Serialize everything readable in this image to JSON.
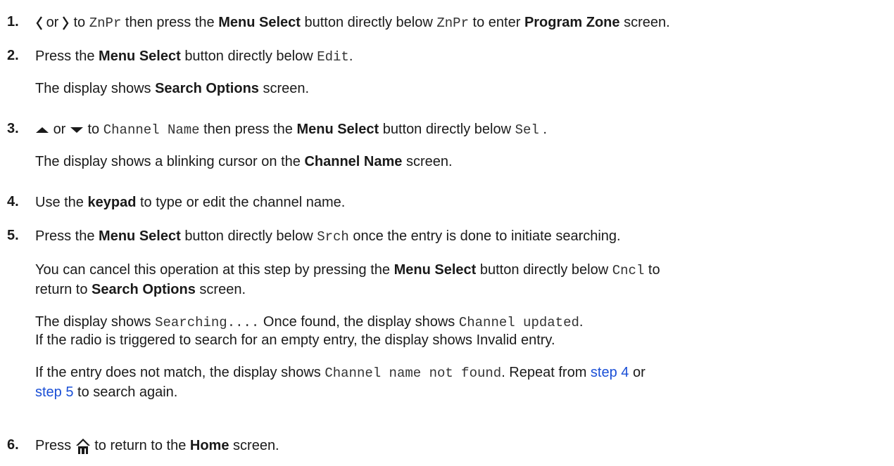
{
  "steps": [
    {
      "num": "1.",
      "l1": {
        "or": "or",
        "to": "to",
        "code1": "ZnPr",
        "t1": "then press the",
        "b1": "Menu Select",
        "t2": "button directly below",
        "code2": "ZnPr",
        "t3": "to enter",
        "b2": "Program Zone",
        "t4": "screen."
      }
    },
    {
      "num": "2.",
      "l1": {
        "t1": "Press the",
        "b1": "Menu Select",
        "t2": "button directly below",
        "code1": "Edit",
        "t3": "."
      },
      "l2": {
        "t1": "The display shows",
        "b1": "Search Options",
        "t2": "screen."
      }
    },
    {
      "num": "3.",
      "l1": {
        "or": "or",
        "to": "to",
        "code1": "Channel Name",
        "t1": "then press the",
        "b1": "Menu Select",
        "t2": "button directly below",
        "code2": "Sel",
        "t3": "."
      },
      "l2": {
        "t1": "The display shows a blinking cursor on the",
        "b1": "Channel Name",
        "t2": "screen."
      }
    },
    {
      "num": "4.",
      "l1": {
        "t1": "Use the",
        "b1": "keypad",
        "t2": "to type or edit the channel name."
      }
    },
    {
      "num": "5.",
      "l1": {
        "t1": "Press the",
        "b1": "Menu Select",
        "t2": "button directly below",
        "code1": "Srch",
        "t3": "once the entry is done to initiate searching."
      },
      "l2": {
        "t1": "You can cancel this operation at this step by pressing the",
        "b1": "Menu Select",
        "t2": "button directly below",
        "code1": "Cncl",
        "t3": "to"
      },
      "l3": {
        "t1": "return to",
        "b1": "Search Options",
        "t2": "screen."
      },
      "l4": {
        "t1": "The display shows",
        "code1": "Searching....",
        "t2": "Once found, the display shows",
        "code2": "Channel updated",
        "t3": "."
      },
      "l5": {
        "t1": "If the radio is triggered to search for an empty entry, the display shows Invalid entry."
      },
      "l6": {
        "t1": "If the entry does not match, the display shows",
        "code1": "Channel name not found",
        "t2": ". Repeat from",
        "link1": "step 4",
        "t3": "or"
      },
      "l7": {
        "link1": "step 5",
        "t1": "to search again."
      }
    },
    {
      "num": "6.",
      "l1": {
        "t1": "Press",
        "t2": "to return to the",
        "b1": "Home",
        "t3": "screen."
      }
    }
  ],
  "icons": [
    "left-arrow-icon",
    "right-arrow-icon",
    "up-arrow-icon",
    "down-arrow-icon",
    "home-icon"
  ],
  "colors": {
    "text": "#1a1a1a",
    "link": "#1a4fd6",
    "mono": "#333333"
  }
}
